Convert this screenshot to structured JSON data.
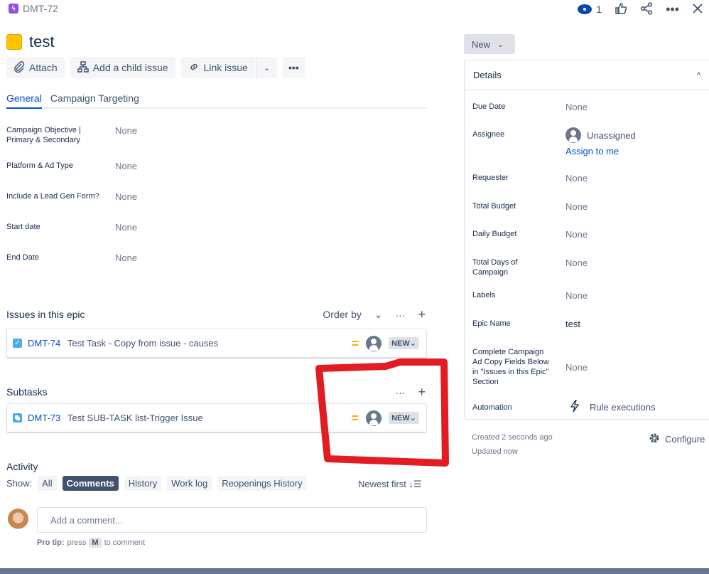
{
  "header": {
    "issue_key": "DMT-72",
    "title": "test",
    "watch_count": "1"
  },
  "toolbar": {
    "attach": "Attach",
    "add_child": "Add a child issue",
    "link_issue": "Link issue"
  },
  "tabs": [
    {
      "label": "General",
      "active": true
    },
    {
      "label": "Campaign Targeting",
      "active": false
    }
  ],
  "general_fields": [
    {
      "label": "Campaign Objective | Primary & Secondary",
      "value": "None"
    },
    {
      "label": "Platform & Ad Type",
      "value": "None"
    },
    {
      "label": "Include a Lead Gen Form?",
      "value": "None"
    },
    {
      "label": "Start date",
      "value": "None"
    },
    {
      "label": "End Date",
      "value": "None"
    }
  ],
  "epic_issues": {
    "title": "Issues in this epic",
    "order_by": "Order by",
    "items": [
      {
        "key": "DMT-74",
        "summary": "Test Task - Copy from issue - causes",
        "status": "NEW"
      }
    ]
  },
  "subtasks": {
    "title": "Subtasks",
    "items": [
      {
        "key": "DMT-73",
        "summary": "Test SUB-TASK list-Trigger Issue",
        "status": "NEW"
      }
    ]
  },
  "activity": {
    "title": "Activity",
    "show_label": "Show:",
    "filters": [
      {
        "label": "All",
        "active": false
      },
      {
        "label": "Comments",
        "active": true
      },
      {
        "label": "History",
        "active": false
      },
      {
        "label": "Work log",
        "active": false
      },
      {
        "label": "Reopenings History",
        "active": false
      }
    ],
    "sort": "Newest first",
    "comment_placeholder": "Add a comment...",
    "protip_prefix": "Pro tip:",
    "protip_press": "press",
    "protip_key": "M",
    "protip_suffix": "to comment"
  },
  "status_button": "New",
  "details": {
    "title": "Details",
    "fields": [
      {
        "label": "Due Date",
        "value": "None"
      },
      {
        "label": "Assignee",
        "value": "Unassigned",
        "action": "Assign to me"
      },
      {
        "label": "Requester",
        "value": "None"
      },
      {
        "label": "Total Budget",
        "value": "None"
      },
      {
        "label": "Daily Budget",
        "value": "None"
      },
      {
        "label": "Total Days of Campaign",
        "value": "None"
      },
      {
        "label": "Labels",
        "value": "None"
      },
      {
        "label": "Epic Name",
        "value": "test"
      },
      {
        "label": "Complete Campaign Ad Copy Fields Below in \"Issues in this Epic\" Section",
        "value": "None"
      },
      {
        "label": "Automation",
        "value": "Rule executions"
      }
    ]
  },
  "meta": {
    "created": "Created 2 seconds ago",
    "updated": "Updated now",
    "configure": "Configure"
  },
  "colors": {
    "link": "#0052cc",
    "epic": "#ffc400",
    "priority": "#ffab00",
    "annotation": "#e31b23"
  }
}
